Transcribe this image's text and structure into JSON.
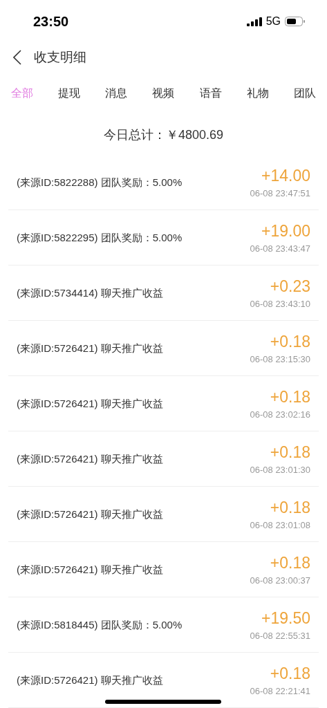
{
  "status_bar": {
    "time": "23:50",
    "network": "5G"
  },
  "header": {
    "title": "收支明细"
  },
  "tabs": [
    {
      "label": "全部",
      "selected": true
    },
    {
      "label": "提现",
      "selected": false
    },
    {
      "label": "消息",
      "selected": false
    },
    {
      "label": "视频",
      "selected": false
    },
    {
      "label": "语音",
      "selected": false
    },
    {
      "label": "礼物",
      "selected": false
    },
    {
      "label": "团队",
      "selected": false
    }
  ],
  "summary": {
    "label": "今日总计：",
    "amount": "￥4800.69"
  },
  "records": [
    {
      "description": "(来源ID:5822288) 团队奖励：5.00%",
      "amount": "+14.00",
      "time": "06-08 23:47:51"
    },
    {
      "description": "(来源ID:5822295) 团队奖励：5.00%",
      "amount": "+19.00",
      "time": "06-08 23:43:47"
    },
    {
      "description": "(来源ID:5734414) 聊天推广收益",
      "amount": "+0.23",
      "time": "06-08 23:43:10"
    },
    {
      "description": "(来源ID:5726421) 聊天推广收益",
      "amount": "+0.18",
      "time": "06-08 23:15:30"
    },
    {
      "description": "(来源ID:5726421) 聊天推广收益",
      "amount": "+0.18",
      "time": "06-08 23:02:16"
    },
    {
      "description": "(来源ID:5726421) 聊天推广收益",
      "amount": "+0.18",
      "time": "06-08 23:01:30"
    },
    {
      "description": "(来源ID:5726421) 聊天推广收益",
      "amount": "+0.18",
      "time": "06-08 23:01:08"
    },
    {
      "description": "(来源ID:5726421) 聊天推广收益",
      "amount": "+0.18",
      "time": "06-08 23:00:37"
    },
    {
      "description": "(来源ID:5818445) 团队奖励：5.00%",
      "amount": "+19.50",
      "time": "06-08 22:55:31"
    },
    {
      "description": "(来源ID:5726421) 聊天推广收益",
      "amount": "+0.18",
      "time": "06-08 22:21:41"
    }
  ]
}
